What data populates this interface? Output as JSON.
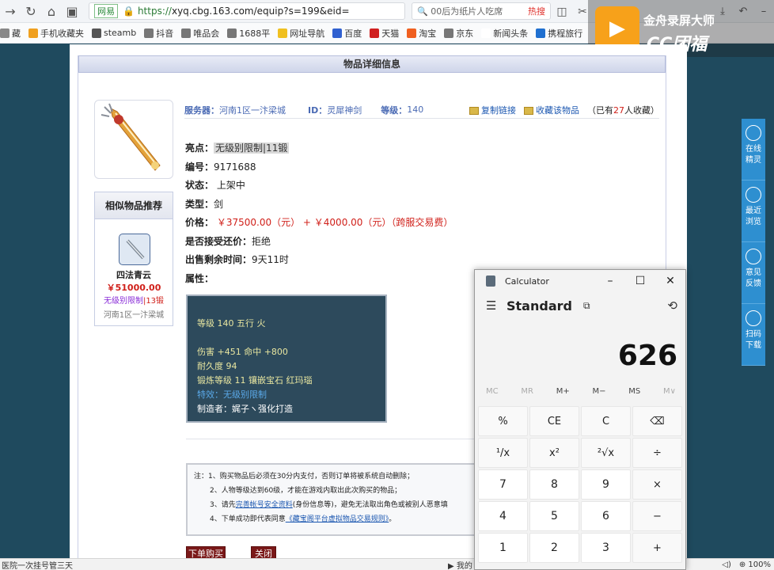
{
  "browser": {
    "url_site_label": "网易",
    "url_scheme": "https://",
    "url_host": "xyq.cbg.163.com/equip?s=199&eid=",
    "search_text": "00后为纸片人吃席",
    "search_hot": "热搜"
  },
  "bookmarks": [
    {
      "label": "藏",
      "color": "#888888"
    },
    {
      "label": "手机收藏夹",
      "color": "#f0a020"
    },
    {
      "label": "steamb",
      "color": "#555555"
    },
    {
      "label": "抖音",
      "color": "#777777"
    },
    {
      "label": "唯品会",
      "color": "#777777"
    },
    {
      "label": "1688平",
      "color": "#777777"
    },
    {
      "label": "网址导航",
      "color": "#f0c020"
    },
    {
      "label": "百度",
      "color": "#3060d0"
    },
    {
      "label": "天猫",
      "color": "#d02020"
    },
    {
      "label": "淘宝",
      "color": "#f06020"
    },
    {
      "label": "京东",
      "color": "#777777"
    },
    {
      "label": "新闻头条",
      "color": "#ffffff"
    },
    {
      "label": "携程旅行",
      "color": "#2070d0"
    }
  ],
  "recorder": {
    "title": "金舟录屏大师",
    "subtitle": "CC团福"
  },
  "panel": {
    "header": "物品详细信息",
    "server_label": "服务器：",
    "server_value": "河南1区一汴梁城",
    "id_label": "ID：",
    "id_value": "灵犀神剑",
    "level_label": "等级：",
    "level_value": "140",
    "copy_link": "复制链接",
    "favorite": "收藏该物品",
    "fav_count_prefix": "（已有",
    "fav_count": "27",
    "fav_count_suffix": "人收藏）"
  },
  "details": {
    "highlight_label": "亮点：",
    "highlight_value": "无级别限制|11锻",
    "number_label": "编号：",
    "number_value": "9171688",
    "status_label": "状态：",
    "status_value": "上架中",
    "type_label": "类型：",
    "type_value": "剑",
    "price_label": "价格：",
    "price_value": "￥37500.00（元） + ￥4000.00（元）（跨服交易费）",
    "counter_label": "是否接受还价：",
    "counter_value": "拒绝",
    "time_label": "出售剩余时间：",
    "time_value": "9天11时",
    "attr_label": "属性："
  },
  "attrs": {
    "line1": "等级 140 五行 火",
    "line2": "伤害 +451 命中 +800",
    "line3": "耐久度 94",
    "line4": "锻炼等级 11 镶嵌宝石 红玛瑙",
    "line5": "特效：无级别限制",
    "line6": "制造者：娓子ヽ强化打造"
  },
  "similar": {
    "title": "相似物品推荐",
    "name": "四法青云",
    "price": "￥51000.00",
    "tag": "无级别限制",
    "tag_suffix": "|13锻",
    "server": "河南1区一汴梁城"
  },
  "notes": {
    "n1": "注：1、购买物品后必须在30分内支付，否则订单将被系统自动删除；",
    "n2": "2、人物等级达到60级，才能在游戏内取出此次购买的物品；",
    "n3_pre": "3、请先",
    "n3_link": "完善帐号安全资料",
    "n3_post": "(身份信息等)，避免无法取出角色或被别人恶意填",
    "n4_pre": "4、下单成功即代表同意",
    "n4_link": "《藏宝阁平台虚拟物品交易规则》",
    "n4_post": "。"
  },
  "buttons": {
    "buy": "下单购买",
    "close": "关闭"
  },
  "sidetools": [
    {
      "label": "在线精灵"
    },
    {
      "label": "最近浏览"
    },
    {
      "label": "意见反馈"
    },
    {
      "label": "扫码下载"
    }
  ],
  "statusbar": {
    "left": "医院一次挂号管三天",
    "mid": "我的",
    "zoom": "100%"
  },
  "calculator": {
    "app_title": "Calculator",
    "mode": "Standard",
    "display": "626",
    "memory": [
      "MC",
      "MR",
      "M+",
      "M−",
      "MS",
      "M∨"
    ],
    "keys": [
      "%",
      "CE",
      "C",
      "⌫",
      "¹/x",
      "x²",
      "²√x",
      "÷",
      "7",
      "8",
      "9",
      "×",
      "4",
      "5",
      "6",
      "−",
      "1",
      "2",
      "3",
      "+"
    ]
  }
}
